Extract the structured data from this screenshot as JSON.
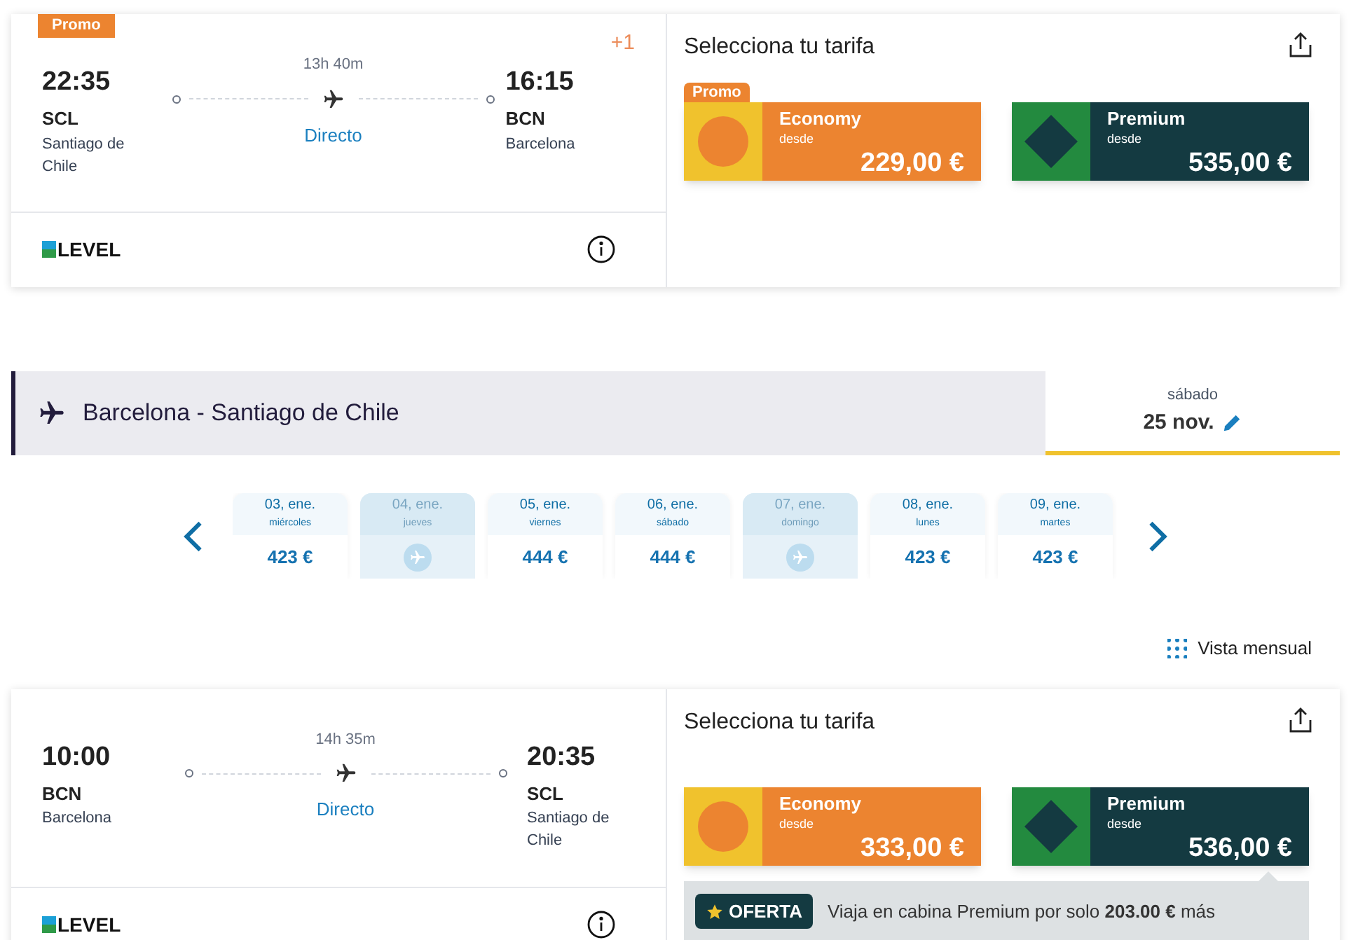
{
  "flights": [
    {
      "promo": "Promo",
      "departure": {
        "time": "22:35",
        "code": "SCL",
        "city": "Santiago de Chile"
      },
      "duration": "13h 40m",
      "stops": "Directo",
      "arrival": {
        "time": "16:15",
        "code": "BCN",
        "city": "Barcelona"
      },
      "day_offset": "+1",
      "airline": "LEVEL",
      "fare_title": "Selecciona tu tarifa",
      "fares": [
        {
          "kind": "economy",
          "promo": "Promo",
          "name": "Economy",
          "from": "desde",
          "price": "229,00 €"
        },
        {
          "kind": "premium",
          "name": "Premium",
          "from": "desde",
          "price": "535,00 €"
        }
      ]
    }
  ],
  "section": {
    "route": "Barcelona - Santiago de Chile",
    "weekday": "sábado",
    "date": "25 nov."
  },
  "days": [
    {
      "kind": "available",
      "date": "03, ene.",
      "weekday": "miércoles",
      "price": "423 €"
    },
    {
      "kind": "unavailable",
      "date": "04, ene.",
      "weekday": "jueves"
    },
    {
      "kind": "available",
      "date": "05, ene.",
      "weekday": "viernes",
      "price": "444 €"
    },
    {
      "kind": "available",
      "date": "06, ene.",
      "weekday": "sábado",
      "price": "444 €"
    },
    {
      "kind": "unavailable",
      "date": "07, ene.",
      "weekday": "domingo"
    },
    {
      "kind": "available",
      "date": "08, ene.",
      "weekday": "lunes",
      "price": "423 €"
    },
    {
      "kind": "available",
      "date": "09, ene.",
      "weekday": "martes",
      "price": "423 €"
    }
  ],
  "monthly_view": "Vista mensual",
  "flights2": [
    {
      "departure": {
        "time": "10:00",
        "code": "BCN",
        "city": "Barcelona"
      },
      "duration": "14h 35m",
      "stops": "Directo",
      "arrival": {
        "time": "20:35",
        "code": "SCL",
        "city": "Santiago de Chile"
      },
      "airline": "LEVEL",
      "fare_title": "Selecciona tu tarifa",
      "fares": [
        {
          "kind": "economy",
          "name": "Economy",
          "from": "desde",
          "price": "333,00 €"
        },
        {
          "kind": "premium",
          "name": "Premium",
          "from": "desde",
          "price": "536,00 €"
        }
      ],
      "offer": {
        "badge": "OFERTA",
        "text": "Viaja en cabina Premium por solo **203.00 €** más"
      }
    }
  ]
}
